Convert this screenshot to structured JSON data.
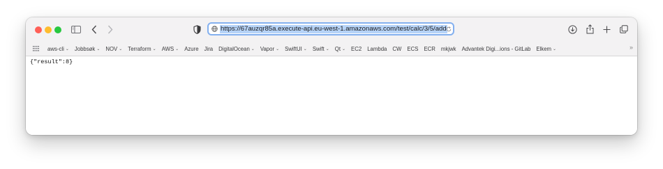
{
  "browser": {
    "url": "https://67auzqr85a.execute-api.eu-west-1.amazonaws.com/test/calc/3/5/add",
    "traffic_lights": {
      "close": "#ff5f57",
      "minimize": "#febc2e",
      "zoom": "#28c840"
    },
    "accent_color": "#83b0ef"
  },
  "toolbar": {
    "icons": [
      "sidebar-icon",
      "back-icon",
      "forward-icon",
      "privacy-shield-icon",
      "globe-icon",
      "reload-icon",
      "download-icon",
      "share-icon",
      "new-tab-icon",
      "tabs-overview-icon"
    ]
  },
  "bookmarks": [
    {
      "label": "aws-cli",
      "has_menu": true
    },
    {
      "label": "Jobbsøk",
      "has_menu": true
    },
    {
      "label": "NOV",
      "has_menu": true
    },
    {
      "label": "Terraform",
      "has_menu": true
    },
    {
      "label": "AWS",
      "has_menu": true
    },
    {
      "label": "Azure",
      "has_menu": false
    },
    {
      "label": "Jira",
      "has_menu": false
    },
    {
      "label": "DigitalOcean",
      "has_menu": true
    },
    {
      "label": "Vapor",
      "has_menu": true
    },
    {
      "label": "SwiftUI",
      "has_menu": true
    },
    {
      "label": "Swift",
      "has_menu": true
    },
    {
      "label": "Qt",
      "has_menu": true
    },
    {
      "label": "EC2",
      "has_menu": false
    },
    {
      "label": "Lambda",
      "has_menu": false
    },
    {
      "label": "CW",
      "has_menu": false
    },
    {
      "label": "ECS",
      "has_menu": false
    },
    {
      "label": "ECR",
      "has_menu": false
    },
    {
      "label": "mkjwk",
      "has_menu": false
    },
    {
      "label": "Advantek Digi...ions - GitLab",
      "has_menu": false
    },
    {
      "label": "Elkem",
      "has_menu": true
    }
  ],
  "bookmarks_more": "»",
  "page": {
    "body_text": "{\"result\":8}"
  }
}
